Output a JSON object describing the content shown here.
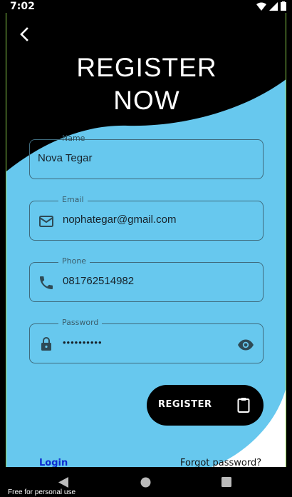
{
  "status_bar": {
    "time": "7:02"
  },
  "header": {
    "title_line1": "REGISTER",
    "title_line2": "NOW"
  },
  "form": {
    "name": {
      "label": "Name",
      "value": "Nova Tegar"
    },
    "email": {
      "label": "Email",
      "value": "nophategar@gmail.com",
      "icon": "mail-icon"
    },
    "phone": {
      "label": "Phone",
      "value": "081762514982",
      "icon": "phone-icon"
    },
    "password": {
      "label": "Password",
      "value": "••••••••••",
      "icon": "lock-icon",
      "toggle_icon": "eye-icon"
    }
  },
  "actions": {
    "register_label": "REGISTER",
    "register_icon": "clipboard-icon",
    "login_label": "Login",
    "forgot_label": "Forgot password?"
  },
  "watermark": "Free for personal use",
  "colors": {
    "background": "#67C8EE",
    "header": "#000000",
    "link": "#0B2BD1"
  }
}
